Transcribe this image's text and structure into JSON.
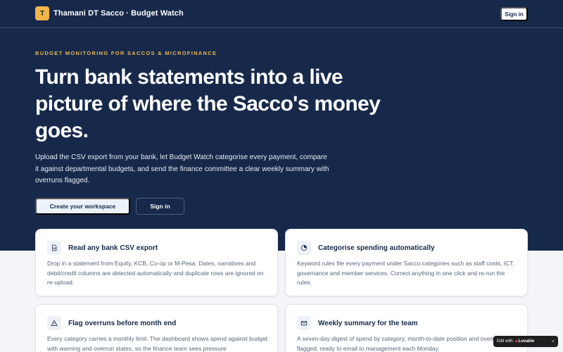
{
  "brand": {
    "initial": "T",
    "name": "Thamani DT Sacco · Budget Watch"
  },
  "topbar": {
    "signin_label": "Sign in"
  },
  "hero": {
    "eyebrow": "Budget monitoring for Saccos & microfinance",
    "headline": "Turn bank statements into a live picture of where the Sacco's money goes.",
    "lead": "Upload the CSV export from your bank, let Budget Watch categorise every payment, compare it against departmental budgets, and send the finance committee a clear weekly summary with overruns flagged.",
    "primary_cta": "Create your workspace",
    "secondary_cta": "Sign in"
  },
  "features": [
    {
      "icon": "file-icon",
      "title": "Read any bank CSV export",
      "body": "Drop in a statement from Equity, KCB, Co-op or M-Pesa. Dates, narratives and debit/credit columns are detected automatically and duplicate rows are ignored on re-upload."
    },
    {
      "icon": "pie-chart-icon",
      "title": "Categorise spending automatically",
      "body": "Keyword rules file every payment under Sacco categories such as staff costs, ICT, governance and member services. Correct anything in one click and re-run the rules."
    },
    {
      "icon": "warning-icon",
      "title": "Flag overruns before month end",
      "body": "Every category carries a monthly limit. The dashboard shows spend against budget with warning and overrun states, so the finance team sees pressure"
    },
    {
      "icon": "mail-icon",
      "title": "Weekly summary for the team",
      "body": "A seven-day digest of spend by category, month-to-date position and overrun flagged, ready to email to management each Monday."
    }
  ],
  "edit_badge": {
    "text": "Edit with",
    "brand": "Lovable",
    "close": "×"
  },
  "colors": {
    "hero_bg": "#17294b",
    "accent": "#e8b64f",
    "page_bg": "#f3f5f8"
  }
}
